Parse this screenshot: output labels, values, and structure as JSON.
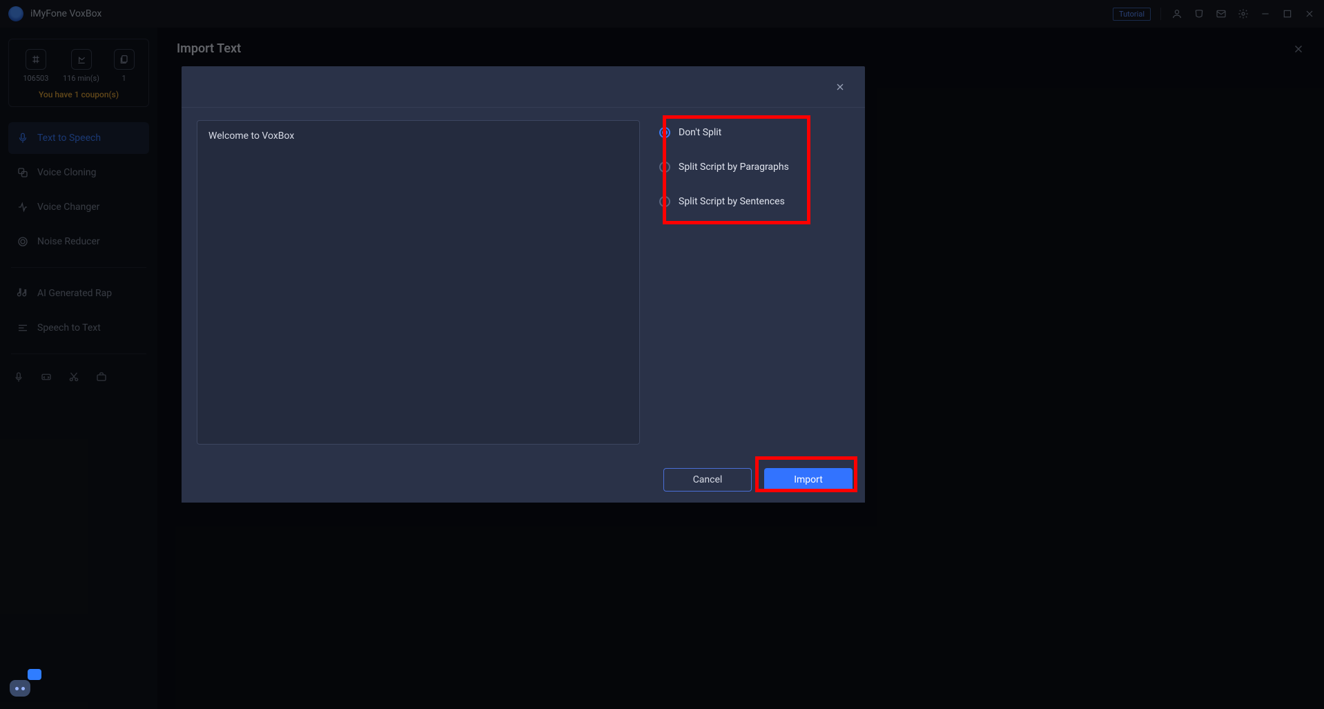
{
  "app": {
    "title": "iMyFone VoxBox"
  },
  "titlebar": {
    "tutorial": "Tutorial"
  },
  "stats": {
    "chars": "106503",
    "minutes": "116 min(s)",
    "files": "1",
    "coupon": "You have 1 coupon(s)"
  },
  "sidebar": {
    "items": [
      {
        "label": "Text to Speech"
      },
      {
        "label": "Voice Cloning"
      },
      {
        "label": "Voice Changer"
      },
      {
        "label": "Noise Reducer"
      },
      {
        "label": "AI Generated Rap"
      },
      {
        "label": "Speech to Text"
      }
    ]
  },
  "page": {
    "title": "Import Text"
  },
  "modal": {
    "text": "Welcome to VoxBox",
    "options": [
      {
        "label": "Don't Split"
      },
      {
        "label": "Split Script by Paragraphs"
      },
      {
        "label": "Split Script by Sentences"
      }
    ],
    "cancel": "Cancel",
    "import": "Import"
  }
}
